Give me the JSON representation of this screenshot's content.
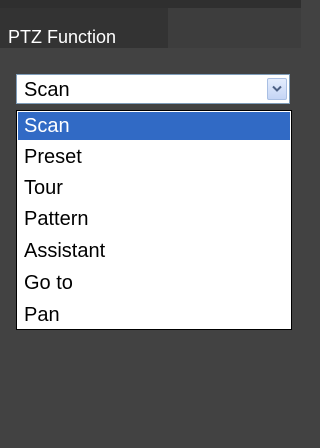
{
  "panel": {
    "title": "PTZ Function"
  },
  "function_select": {
    "selected": "Scan",
    "options": [
      "Scan",
      "Preset",
      "Tour",
      "Pattern",
      "Assistant",
      "Go to",
      "Pan"
    ],
    "arrow_icon": "chevron-down-icon"
  },
  "colors": {
    "panel_background": "#424242",
    "selected_option": "#316ac5",
    "dropdown_border": "#000000"
  }
}
